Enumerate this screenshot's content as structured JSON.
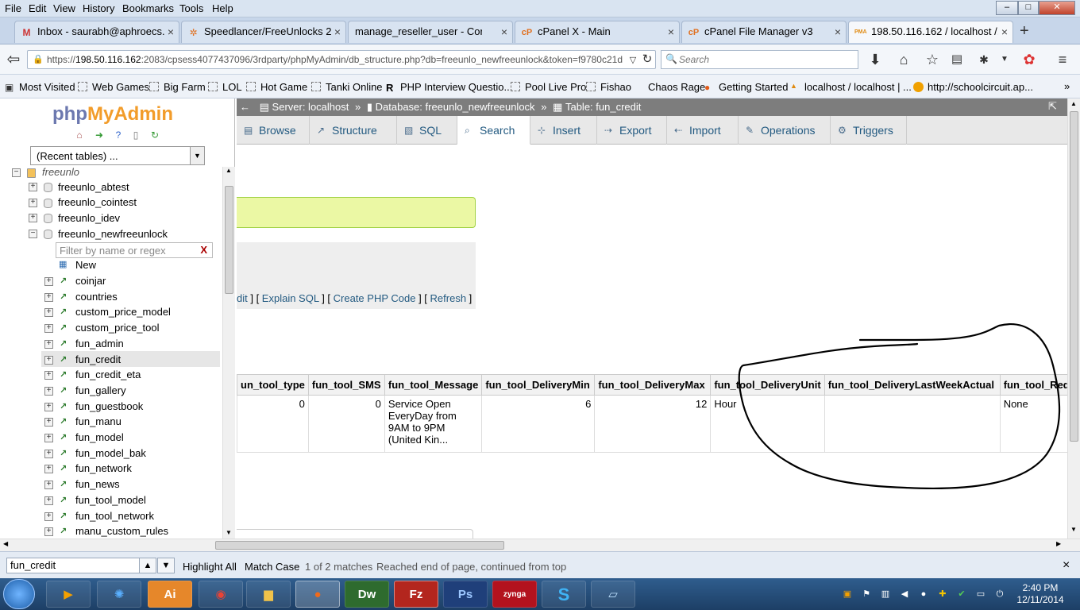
{
  "menubar": {
    "items": [
      "File",
      "Edit",
      "View",
      "History",
      "Bookmarks",
      "Tools",
      "Help"
    ],
    "window_buttons": [
      "–",
      "□",
      "✕"
    ]
  },
  "tabs": [
    {
      "icon": "M",
      "label": "Inbox - saurabh@aphroecs....",
      "close": "×"
    },
    {
      "icon": "✲",
      "label": "Speedlancer/FreeUnlocks 2...",
      "close": "×"
    },
    {
      "icon": "",
      "label": "manage_reseller_user - Corpun...",
      "close": "×"
    },
    {
      "icon": "cP",
      "label": "cPanel X - Main",
      "close": "×"
    },
    {
      "icon": "cP",
      "label": "cPanel File Manager v3",
      "close": "×"
    },
    {
      "icon": "PMA",
      "label": "198.50.116.162 / localhost /...",
      "close": "×"
    }
  ],
  "new_tab": "+",
  "nav": {
    "url_prefix": "https://",
    "url_host": "198.50.116.162",
    "url_rest": ":2083/cpsess4077437096/3rdparty/phpMyAdmin/db_structure.php?db=freeunlo_newfreeunlock&token=f9780c21d",
    "search_placeholder": "Search"
  },
  "bookmarks": [
    "Most Visited",
    "Web Games",
    "Big Farm",
    "LOL",
    "Hot Game",
    "Tanki Online",
    "PHP Interview Questio...",
    "Pool Live Pro",
    "Fishao",
    "Chaos Rage",
    "Getting Started",
    "localhost / localhost | ...",
    "http://schoolcircuit.ap..."
  ],
  "pma": {
    "logo_php": "php",
    "logo_ma": "MyAdmin",
    "recent_tables": "(Recent tables) ...",
    "root": "freeunlo",
    "databases": [
      "freeunlo_abtest",
      "freeunlo_cointest",
      "freeunlo_idev",
      "freeunlo_newfreeunlock"
    ],
    "filter_placeholder": "Filter by name or regex",
    "filter_clear": "X",
    "new_label": "New",
    "tables": [
      "coinjar",
      "countries",
      "custom_price_model",
      "custom_price_tool",
      "fun_admin",
      "fun_credit",
      "fun_credit_eta",
      "fun_gallery",
      "fun_guestbook",
      "fun_manu",
      "fun_model",
      "fun_model_bak",
      "fun_network",
      "fun_news",
      "fun_tool_model",
      "fun_tool_network",
      "manu_custom_rules"
    ]
  },
  "breadcrumb": {
    "server": "Server: localhost",
    "database": "Database: freeunlo_newfreeunlock",
    "table": "Table: fun_credit",
    "sep": "»"
  },
  "top_tabs": [
    "Browse",
    "Structure",
    "SQL",
    "Search",
    "Insert",
    "Export",
    "Import",
    "Operations",
    "Triggers"
  ],
  "sql_links": {
    "edit": "dit",
    "explain": "Explain SQL",
    "php": "Create PHP Code",
    "refresh": "Refresh"
  },
  "results": {
    "headers": [
      "un_tool_type",
      "fun_tool_SMS",
      "fun_tool_Message",
      "fun_tool_DeliveryMin",
      "fun_tool_DeliveryMax",
      "fun_tool_DeliveryUnit",
      "fun_tool_DeliveryLastWeekActual",
      "fun_tool_Requ"
    ],
    "row": [
      "0",
      "0",
      "Service Open EveryDay from 9AM to 9PM (United Kin...",
      "6",
      "12",
      "Hour",
      "",
      "None"
    ]
  },
  "findbar": {
    "value": "fun_credit",
    "highlight_all": "Highlight All",
    "match_case": "Match Case",
    "matches": "1 of 2 matches",
    "status": "Reached end of page, continued from top",
    "close": "×"
  },
  "taskbar": {
    "apps": [
      "",
      "",
      "Ai",
      "",
      "",
      "",
      "Dw",
      "Fz",
      "Ps",
      "zynga",
      "S",
      ""
    ],
    "time": "2:40 PM",
    "date": "12/11/2014"
  },
  "colors": {
    "pma_link": "#235a81",
    "success_bg": "#ebf8a4",
    "annotation": "#000000"
  }
}
